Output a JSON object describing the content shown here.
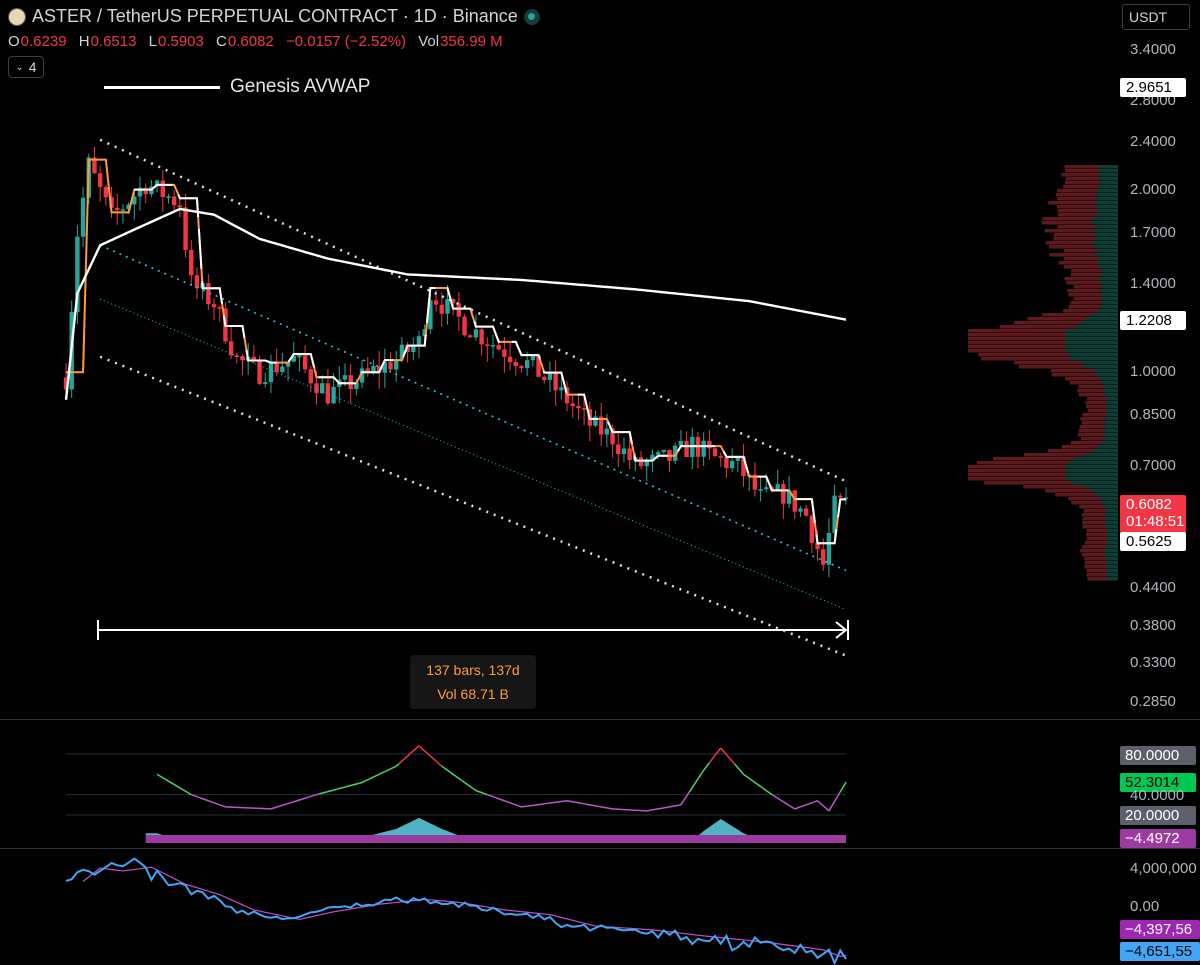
{
  "header": {
    "title": "ASTER / TetherUS PERPETUAL CONTRACT · 1D · Binance",
    "ohlc": {
      "o_label": "O",
      "o": "0.6239",
      "h_label": "H",
      "h": "0.6513",
      "l_label": "L",
      "l": "0.5903",
      "c_label": "C",
      "c": "0.6082",
      "change": "−0.0157 (−2.52%)",
      "vol_label": "Vol",
      "vol": "356.99 M"
    },
    "indicator_count": "4",
    "currency": "USDT"
  },
  "legend": {
    "label": "Genesis AVWAP"
  },
  "price_axis": {
    "ticks": [
      "3.4000",
      "2.8000",
      "2.4000",
      "2.0000",
      "1.7000",
      "1.4000",
      "1.0000",
      "0.8500",
      "0.7000",
      "0.4400",
      "0.3800",
      "0.3300",
      "0.2850"
    ],
    "badges": {
      "avwap_genesis": "2.9651",
      "avwap": "1.2208",
      "last_price": "0.6082",
      "countdown": "01:48:51",
      "level": "0.5625"
    }
  },
  "measure": {
    "bars": "137 bars, 137d",
    "vol": "Vol 68.71 B"
  },
  "oscillator": {
    "badges": {
      "upper": "80.0000",
      "value": "52.3014",
      "mid": "40.0000",
      "lower": "20.0000",
      "hist": "−4.4972"
    }
  },
  "flow": {
    "ticks": [
      "4,000,000",
      "0.00"
    ],
    "badges": {
      "signal": "−4,397,56",
      "value": "−4,651,55"
    }
  },
  "colors": {
    "bull": "#26a69a",
    "bear": "#f23645",
    "avwap": "#ffffff",
    "stop_up": "#ffffff",
    "stop_dn": "#ff9b3d",
    "channel": "#e0e0e0",
    "mid_channel": "#26c6da",
    "profile_up": "#0e3d35",
    "profile_dn": "#5c1a1e",
    "rsi_hi": "#f23645",
    "rsi_lo": "#bc5dcc",
    "rsi_mid": "#4cd964",
    "flow_line": "#42a5f5",
    "flow_sig": "#c44fcf"
  },
  "chart_data": [
    {
      "type": "candlestick",
      "title": "ASTER / TetherUS PERPETUAL CONTRACT · 1D · Binance",
      "scale": "log",
      "ylim": [
        0.27,
        3.6
      ],
      "bars": 137,
      "series": [
        {
          "name": "Genesis AVWAP",
          "kind": "line",
          "y_key": [
            [
              0,
              0.9
            ],
            [
              2,
              1.35
            ],
            [
              6,
              1.62
            ],
            [
              12,
              1.72
            ],
            [
              20,
              1.86
            ],
            [
              26,
              1.82
            ],
            [
              34,
              1.66
            ],
            [
              46,
              1.54
            ],
            [
              60,
              1.45
            ],
            [
              80,
              1.42
            ],
            [
              100,
              1.37
            ],
            [
              120,
              1.31
            ],
            [
              137,
              1.2208
            ]
          ]
        }
      ],
      "close_key": [
        [
          0,
          0.98
        ],
        [
          2,
          1.7
        ],
        [
          4,
          2.2
        ],
        [
          8,
          1.8
        ],
        [
          14,
          2.05
        ],
        [
          20,
          1.9
        ],
        [
          22,
          1.4
        ],
        [
          26,
          1.3
        ],
        [
          30,
          1.05
        ],
        [
          34,
          1.0
        ],
        [
          40,
          1.05
        ],
        [
          46,
          0.92
        ],
        [
          52,
          0.98
        ],
        [
          58,
          1.05
        ],
        [
          62,
          1.12
        ],
        [
          64,
          1.35
        ],
        [
          70,
          1.2
        ],
        [
          76,
          1.1
        ],
        [
          82,
          1.02
        ],
        [
          88,
          0.9
        ],
        [
          92,
          0.82
        ],
        [
          96,
          0.78
        ],
        [
          100,
          0.7
        ],
        [
          106,
          0.72
        ],
        [
          110,
          0.76
        ],
        [
          114,
          0.72
        ],
        [
          118,
          0.7
        ],
        [
          122,
          0.62
        ],
        [
          126,
          0.63
        ],
        [
          130,
          0.58
        ],
        [
          133,
          0.48
        ],
        [
          135,
          0.6
        ],
        [
          137,
          0.6082
        ]
      ],
      "channel": {
        "upper": [
          [
            6,
            2.42
          ],
          [
            137,
            0.66
          ]
        ],
        "lower": [
          [
            6,
            1.06
          ],
          [
            137,
            0.34
          ]
        ],
        "mid": [
          [
            6,
            1.62
          ],
          [
            137,
            0.47
          ]
        ]
      }
    },
    {
      "type": "line",
      "name": "oscillator",
      "ylim": [
        0,
        100
      ],
      "levels": [
        80,
        40,
        20
      ],
      "last": 52.3014,
      "y_key": [
        [
          16,
          60
        ],
        [
          22,
          40
        ],
        [
          28,
          28
        ],
        [
          36,
          26
        ],
        [
          44,
          40
        ],
        [
          52,
          52
        ],
        [
          58,
          68
        ],
        [
          62,
          88
        ],
        [
          66,
          68
        ],
        [
          72,
          44
        ],
        [
          80,
          28
        ],
        [
          88,
          34
        ],
        [
          96,
          26
        ],
        [
          102,
          24
        ],
        [
          108,
          30
        ],
        [
          112,
          64
        ],
        [
          115,
          86
        ],
        [
          119,
          60
        ],
        [
          124,
          40
        ],
        [
          128,
          26
        ],
        [
          132,
          34
        ],
        [
          134,
          24
        ],
        [
          137,
          52.3
        ]
      ]
    },
    {
      "type": "line",
      "name": "flow",
      "ylim": [
        -6500000,
        5500000
      ],
      "last": -4651550,
      "signal_last": -4397560,
      "y_key": [
        [
          0,
          2800000
        ],
        [
          3,
          4200000
        ],
        [
          7,
          3900000
        ],
        [
          12,
          4300000
        ],
        [
          18,
          2500000
        ],
        [
          24,
          1400000
        ],
        [
          30,
          -200000
        ],
        [
          38,
          -1200000
        ],
        [
          44,
          -400000
        ],
        [
          52,
          400000
        ],
        [
          60,
          900000
        ],
        [
          66,
          600000
        ],
        [
          74,
          -200000
        ],
        [
          82,
          -700000
        ],
        [
          90,
          -1900000
        ],
        [
          100,
          -2300000
        ],
        [
          110,
          -3000000
        ],
        [
          120,
          -3600000
        ],
        [
          130,
          -4400000
        ],
        [
          133,
          -5100000
        ],
        [
          137,
          -4651550
        ]
      ]
    }
  ]
}
